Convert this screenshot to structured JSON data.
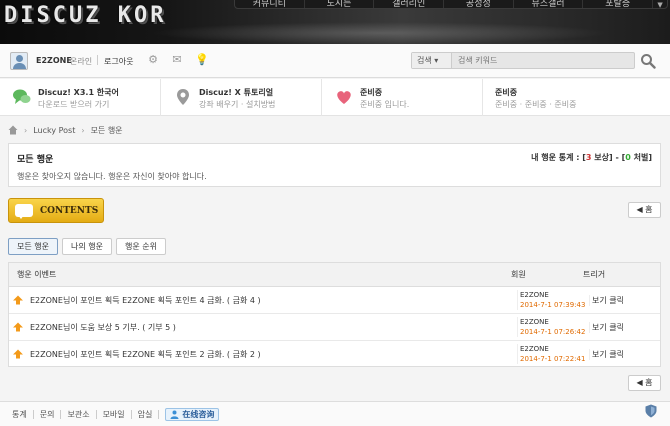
{
  "header": {
    "logo": "DISCUZ KOR",
    "nav": [
      "커뮤니티",
      "도시는",
      "갤러리인",
      "공성성",
      "뮤즈갤러",
      "포탈증"
    ]
  },
  "userbar": {
    "username": "E2ZONE",
    "status": "온라인",
    "logout": "로그아웃",
    "icons": [
      "gear-icon",
      "mail-icon",
      "bulb-icon"
    ],
    "search": {
      "scope": "검색",
      "placeholder": "검색 키워드"
    }
  },
  "promos": [
    {
      "title": "Discuz! X3.1 한국어",
      "sub": "다운로드 받으러 가기",
      "icon": "chat-bubbles-icon"
    },
    {
      "title": "Discuz! X 튜토리얼",
      "sub": "강좌 배우기 · 설치방법",
      "icon": "location-pin-icon"
    },
    {
      "title": "준비중",
      "sub": "준비중 입니다.",
      "icon": "heart-icon"
    },
    {
      "title": "준비중",
      "sub": "준비중 · 준비중 · 준비중",
      "icon": ""
    }
  ],
  "breadcrumb": [
    "Lucky Post",
    "모든 행운"
  ],
  "main": {
    "title": "모든 행운",
    "stats_label": "내 행운 통계 :",
    "stats_open": "[",
    "stats_reward_num": "3",
    "stats_reward_label": "보상",
    "stats_mid": "] - [",
    "stats_penalty_num": "0",
    "stats_penalty_label": "처벌",
    "stats_close": "]",
    "description": "행운은 찾아오지 않습니다. 행운은 자신이 찾아야 합니다."
  },
  "contents_label": "CONTENTS",
  "back_label": "◀ 홈",
  "tabs": [
    "모든 행운",
    "나의 행운",
    "행운 순위"
  ],
  "table": {
    "columns": [
      "행운 이벤트",
      "회원",
      "트리거"
    ],
    "rows": [
      {
        "event": "E2ZONE님이 포인트 획득 E2ZONE 획득 포인트 4 금화. ( 금화 4 )",
        "member": "E2ZONE",
        "time": "2014-7-1 07:39:43",
        "trigger": "보기 클릭"
      },
      {
        "event": "E2ZONE님이 도움 보상 5 기부. ( 기부 5 )",
        "member": "E2ZONE",
        "time": "2014-7-1 07:26:42",
        "trigger": "보기 클릭"
      },
      {
        "event": "E2ZONE님이 포인트 획득 E2ZONE 획득 포인트 2 금화. ( 금화 2 )",
        "member": "E2ZONE",
        "time": "2014-7-1 07:22:41",
        "trigger": "보기 클릭"
      }
    ]
  },
  "footer": {
    "links": [
      "통계",
      "문의",
      "보관소",
      "모바일",
      "암실"
    ],
    "badge": "在线咨询"
  }
}
